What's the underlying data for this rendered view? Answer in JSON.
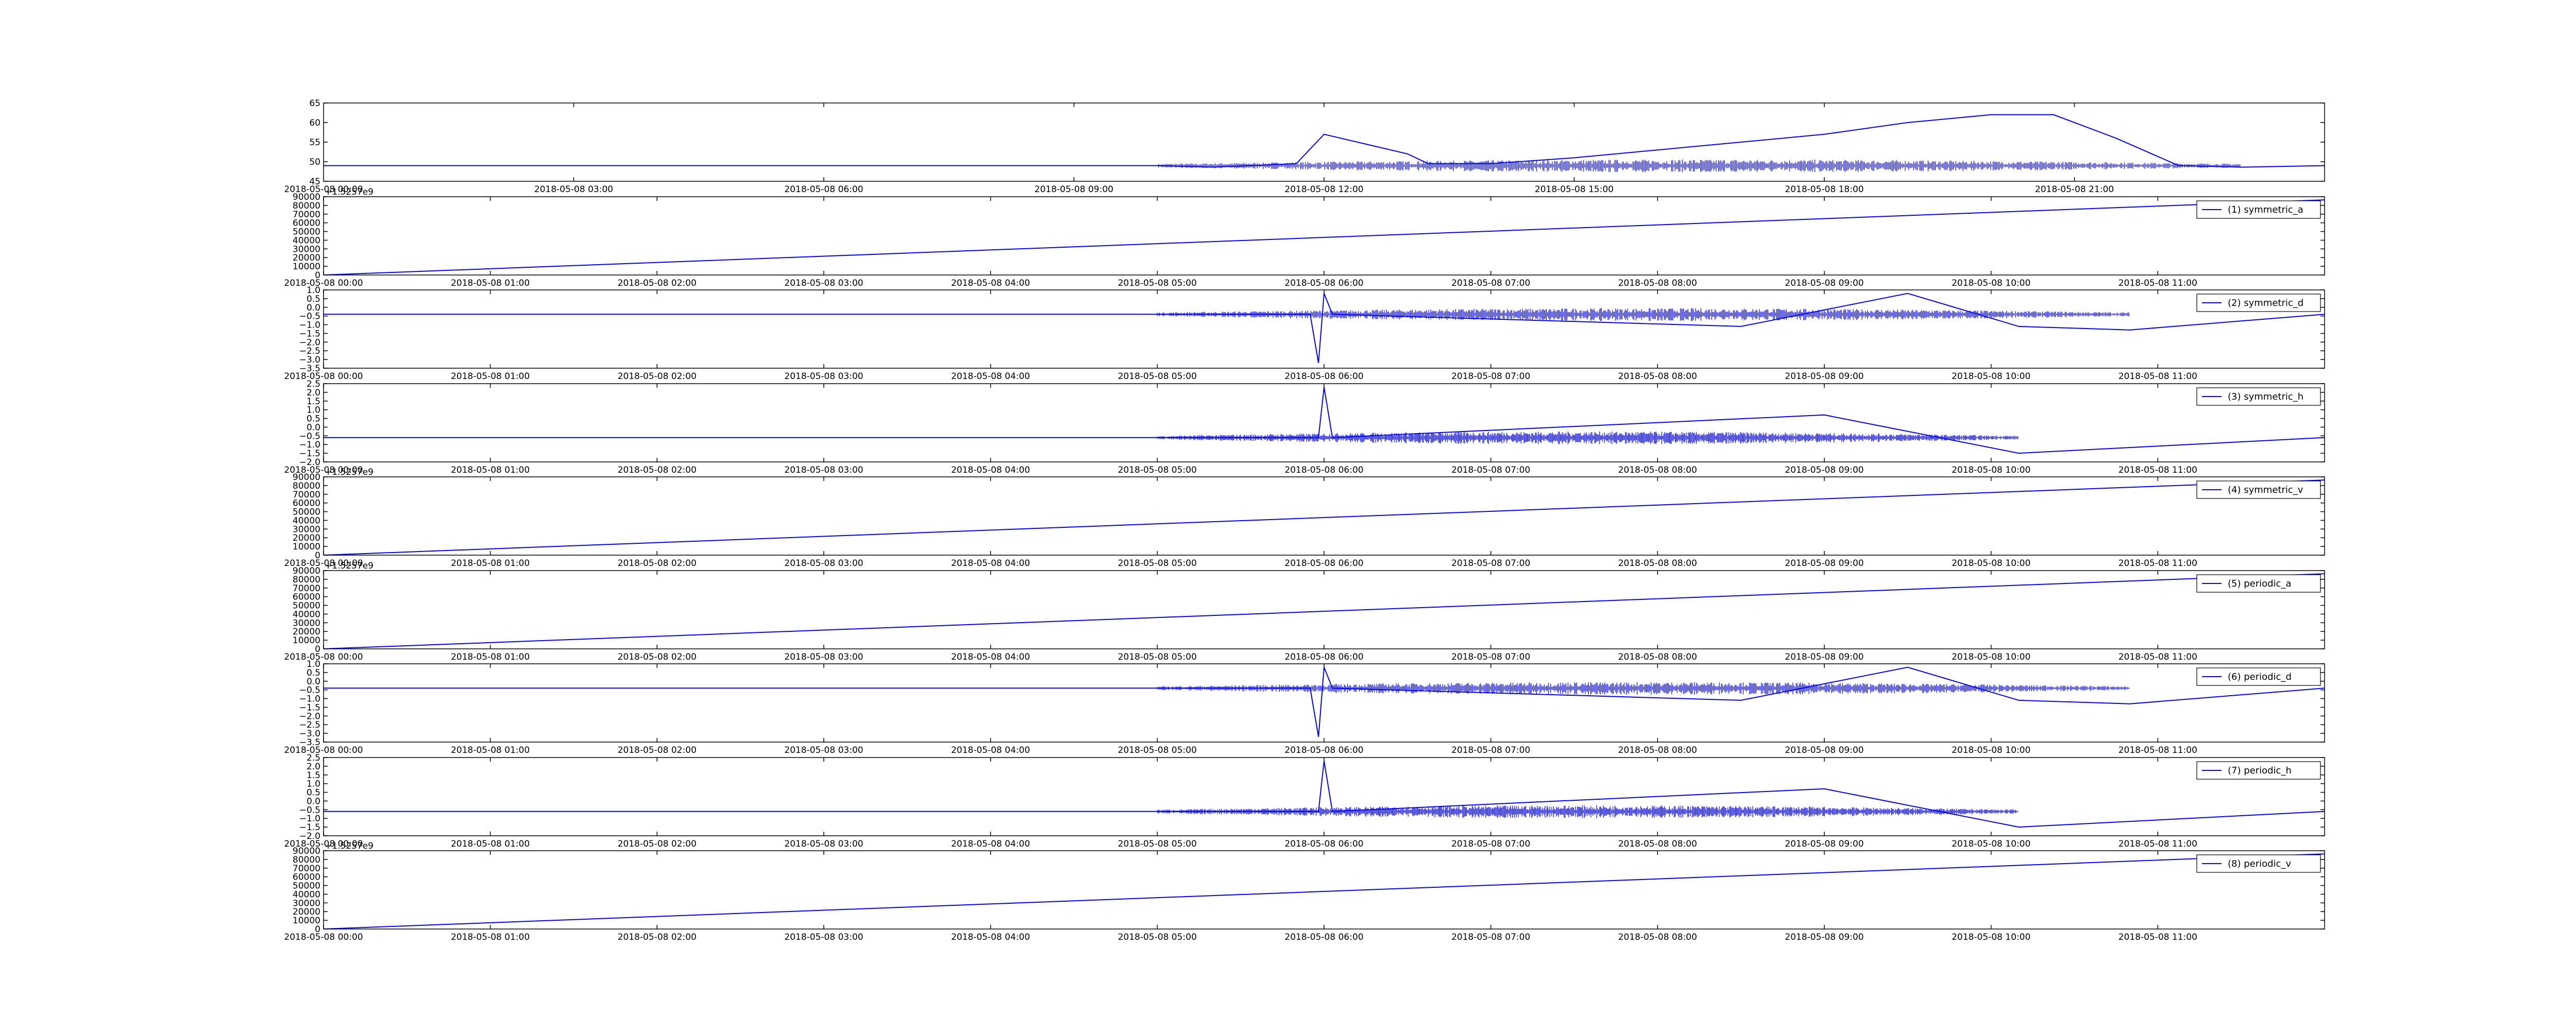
{
  "colors": {
    "line": "#0000ff",
    "axes": "#000000",
    "background": "#ffffff"
  },
  "chart_data": [
    {
      "type": "line",
      "x_axis": "datetime",
      "xlim": [
        "2018-05-08 00:00",
        "2018-05-08 24:00"
      ],
      "xticks": [
        "2018-05-08 03:00",
        "2018-05-08 06:00",
        "2018-05-08 09:00",
        "2018-05-08 12:00",
        "2018-05-08 15:00",
        "2018-05-08 18:00",
        "2018-05-08 21:00"
      ],
      "xtick_labels": [
        "2018-05-08 03:00",
        "2018-05-08 06:00",
        "2018-05-08 09:00",
        "2018-05-08 12:00",
        "2018-05-08 15:00",
        "2018-05-08 18:00",
        "2018-05-08 21:00"
      ],
      "first_xtick_label": "2018-05-08 00:00",
      "ylim": [
        45,
        65
      ],
      "yticks": [
        45,
        50,
        55,
        60,
        65
      ],
      "offset_label": "",
      "legend": "",
      "series": [
        {
          "x": [
            "2018-05-08 00:00",
            "2018-05-08 10:00",
            "2018-05-08 10:40",
            "2018-05-08 11:40",
            "2018-05-08 12:00",
            "2018-05-08 13:00",
            "2018-05-08 13:15",
            "2018-05-08 14:00",
            "2018-05-08 15:00",
            "2018-05-08 16:00",
            "2018-05-08 17:00",
            "2018-05-08 18:00",
            "2018-05-08 19:00",
            "2018-05-08 20:00",
            "2018-05-08 20:45",
            "2018-05-08 21:30",
            "2018-05-08 22:15",
            "2018-05-08 23:00",
            "2018-05-08 24:00"
          ],
          "values": [
            49,
            49,
            48.6,
            49.5,
            57,
            52,
            49.5,
            49.5,
            51,
            53,
            55,
            57,
            60,
            62,
            62,
            56,
            49,
            48.6,
            49
          ]
        }
      ]
    },
    {
      "type": "line",
      "x_axis": "datetime",
      "xlim": [
        "2018-05-08 00:00",
        "2018-05-08 12:00"
      ],
      "xticks": [
        "2018-05-08 00:00",
        "2018-05-08 01:00",
        "2018-05-08 02:00",
        "2018-05-08 03:00",
        "2018-05-08 04:00",
        "2018-05-08 05:00",
        "2018-05-08 06:00",
        "2018-05-08 07:00",
        "2018-05-08 08:00",
        "2018-05-08 09:00",
        "2018-05-08 10:00",
        "2018-05-08 11:00"
      ],
      "xtick_labels": [
        "2018-05-08 00:00",
        "2018-05-08 01:00",
        "2018-05-08 02:00",
        "2018-05-08 03:00",
        "2018-05-08 04:00",
        "2018-05-08 05:00",
        "2018-05-08 06:00",
        "2018-05-08 07:00",
        "2018-05-08 08:00",
        "2018-05-08 09:00",
        "2018-05-08 10:00",
        "2018-05-08 11:00"
      ],
      "ylim": [
        0,
        90000
      ],
      "yticks": [
        0,
        10000,
        20000,
        30000,
        40000,
        50000,
        60000,
        70000,
        80000,
        90000
      ],
      "offset_label": "+1.5257e9",
      "legend": "(1) symmetric_a",
      "series": [
        {
          "name": "(1) symmetric_a",
          "x": [
            "2018-05-08 00:00",
            "2018-05-08 12:00"
          ],
          "values": [
            0,
            86400
          ]
        }
      ]
    },
    {
      "type": "line",
      "x_axis": "datetime",
      "xlim": [
        "2018-05-08 00:00",
        "2018-05-08 12:00"
      ],
      "xticks": [
        "2018-05-08 00:00",
        "2018-05-08 01:00",
        "2018-05-08 02:00",
        "2018-05-08 03:00",
        "2018-05-08 04:00",
        "2018-05-08 05:00",
        "2018-05-08 06:00",
        "2018-05-08 07:00",
        "2018-05-08 08:00",
        "2018-05-08 09:00",
        "2018-05-08 10:00",
        "2018-05-08 11:00"
      ],
      "xtick_labels": [
        "2018-05-08 00:00",
        "2018-05-08 01:00",
        "2018-05-08 02:00",
        "2018-05-08 03:00",
        "2018-05-08 04:00",
        "2018-05-08 05:00",
        "2018-05-08 06:00",
        "2018-05-08 07:00",
        "2018-05-08 08:00",
        "2018-05-08 09:00",
        "2018-05-08 10:00",
        "2018-05-08 11:00"
      ],
      "ylim": [
        -3.5,
        1.0
      ],
      "yticks": [
        -3.5,
        -3.0,
        -2.5,
        -2.0,
        -1.5,
        -1.0,
        -0.5,
        0.0,
        0.5,
        1.0
      ],
      "offset_label": "",
      "legend": "(2) symmetric_d",
      "series": [
        {
          "name": "(2) symmetric_d",
          "x": [
            "2018-05-08 00:00",
            "2018-05-08 05:00",
            "2018-05-08 05:55",
            "2018-05-08 05:58",
            "2018-05-08 06:00",
            "2018-05-08 06:03",
            "2018-05-08 08:30",
            "2018-05-08 09:30",
            "2018-05-08 10:10",
            "2018-05-08 10:50",
            "2018-05-08 12:00"
          ],
          "values": [
            -0.4,
            -0.4,
            -0.4,
            -3.2,
            0.8,
            -0.4,
            -1.1,
            0.8,
            -1.1,
            -1.3,
            -0.4
          ]
        }
      ]
    },
    {
      "type": "line",
      "x_axis": "datetime",
      "xlim": [
        "2018-05-08 00:00",
        "2018-05-08 12:00"
      ],
      "xticks": [
        "2018-05-08 00:00",
        "2018-05-08 01:00",
        "2018-05-08 02:00",
        "2018-05-08 03:00",
        "2018-05-08 04:00",
        "2018-05-08 05:00",
        "2018-05-08 06:00",
        "2018-05-08 07:00",
        "2018-05-08 08:00",
        "2018-05-08 09:00",
        "2018-05-08 10:00",
        "2018-05-08 11:00"
      ],
      "xtick_labels": [
        "2018-05-08 00:00",
        "2018-05-08 01:00",
        "2018-05-08 02:00",
        "2018-05-08 03:00",
        "2018-05-08 04:00",
        "2018-05-08 05:00",
        "2018-05-08 06:00",
        "2018-05-08 07:00",
        "2018-05-08 08:00",
        "2018-05-08 09:00",
        "2018-05-08 10:00",
        "2018-05-08 11:00"
      ],
      "ylim": [
        -2.0,
        2.5
      ],
      "yticks": [
        -2.0,
        -1.5,
        -1.0,
        -0.5,
        0.0,
        0.5,
        1.0,
        1.5,
        2.0,
        2.5
      ],
      "offset_label": "",
      "legend": "(3) symmetric_h",
      "series": [
        {
          "name": "(3) symmetric_h",
          "x": [
            "2018-05-08 00:00",
            "2018-05-08 05:00",
            "2018-05-08 05:58",
            "2018-05-08 06:00",
            "2018-05-08 06:03",
            "2018-05-08 09:00",
            "2018-05-08 10:10",
            "2018-05-08 12:00"
          ],
          "values": [
            -0.6,
            -0.6,
            -0.6,
            2.3,
            -0.6,
            0.7,
            -1.5,
            -0.6
          ]
        }
      ]
    },
    {
      "type": "line",
      "x_axis": "datetime",
      "xlim": [
        "2018-05-08 00:00",
        "2018-05-08 12:00"
      ],
      "xticks": [
        "2018-05-08 00:00",
        "2018-05-08 01:00",
        "2018-05-08 02:00",
        "2018-05-08 03:00",
        "2018-05-08 04:00",
        "2018-05-08 05:00",
        "2018-05-08 06:00",
        "2018-05-08 07:00",
        "2018-05-08 08:00",
        "2018-05-08 09:00",
        "2018-05-08 10:00",
        "2018-05-08 11:00"
      ],
      "xtick_labels": [
        "2018-05-08 00:00",
        "2018-05-08 01:00",
        "2018-05-08 02:00",
        "2018-05-08 03:00",
        "2018-05-08 04:00",
        "2018-05-08 05:00",
        "2018-05-08 06:00",
        "2018-05-08 07:00",
        "2018-05-08 08:00",
        "2018-05-08 09:00",
        "2018-05-08 10:00",
        "2018-05-08 11:00"
      ],
      "ylim": [
        0,
        90000
      ],
      "yticks": [
        0,
        10000,
        20000,
        30000,
        40000,
        50000,
        60000,
        70000,
        80000,
        90000
      ],
      "offset_label": "+1.5257e9",
      "legend": "(4) symmetric_v",
      "series": [
        {
          "name": "(4) symmetric_v",
          "x": [
            "2018-05-08 00:00",
            "2018-05-08 12:00"
          ],
          "values": [
            0,
            86400
          ]
        }
      ]
    },
    {
      "type": "line",
      "x_axis": "datetime",
      "xlim": [
        "2018-05-08 00:00",
        "2018-05-08 12:00"
      ],
      "xticks": [
        "2018-05-08 00:00",
        "2018-05-08 01:00",
        "2018-05-08 02:00",
        "2018-05-08 03:00",
        "2018-05-08 04:00",
        "2018-05-08 05:00",
        "2018-05-08 06:00",
        "2018-05-08 07:00",
        "2018-05-08 08:00",
        "2018-05-08 09:00",
        "2018-05-08 10:00",
        "2018-05-08 11:00"
      ],
      "xtick_labels": [
        "2018-05-08 00:00",
        "2018-05-08 01:00",
        "2018-05-08 02:00",
        "2018-05-08 03:00",
        "2018-05-08 04:00",
        "2018-05-08 05:00",
        "2018-05-08 06:00",
        "2018-05-08 07:00",
        "2018-05-08 08:00",
        "2018-05-08 09:00",
        "2018-05-08 10:00",
        "2018-05-08 11:00"
      ],
      "ylim": [
        0,
        90000
      ],
      "yticks": [
        0,
        10000,
        20000,
        30000,
        40000,
        50000,
        60000,
        70000,
        80000,
        90000
      ],
      "offset_label": "+1.5257e9",
      "legend": "(5) periodic_a",
      "series": [
        {
          "name": "(5) periodic_a",
          "x": [
            "2018-05-08 00:00",
            "2018-05-08 12:00"
          ],
          "values": [
            0,
            86400
          ]
        }
      ]
    },
    {
      "type": "line",
      "x_axis": "datetime",
      "xlim": [
        "2018-05-08 00:00",
        "2018-05-08 12:00"
      ],
      "xticks": [
        "2018-05-08 00:00",
        "2018-05-08 01:00",
        "2018-05-08 02:00",
        "2018-05-08 03:00",
        "2018-05-08 04:00",
        "2018-05-08 05:00",
        "2018-05-08 06:00",
        "2018-05-08 07:00",
        "2018-05-08 08:00",
        "2018-05-08 09:00",
        "2018-05-08 10:00",
        "2018-05-08 11:00"
      ],
      "xtick_labels": [
        "2018-05-08 00:00",
        "2018-05-08 01:00",
        "2018-05-08 02:00",
        "2018-05-08 03:00",
        "2018-05-08 04:00",
        "2018-05-08 05:00",
        "2018-05-08 06:00",
        "2018-05-08 07:00",
        "2018-05-08 08:00",
        "2018-05-08 09:00",
        "2018-05-08 10:00",
        "2018-05-08 11:00"
      ],
      "ylim": [
        -3.5,
        1.0
      ],
      "yticks": [
        -3.5,
        -3.0,
        -2.5,
        -2.0,
        -1.5,
        -1.0,
        -0.5,
        0.0,
        0.5,
        1.0
      ],
      "offset_label": "",
      "legend": "(6) periodic_d",
      "series": [
        {
          "name": "(6) periodic_d",
          "x": [
            "2018-05-08 00:00",
            "2018-05-08 05:00",
            "2018-05-08 05:55",
            "2018-05-08 05:58",
            "2018-05-08 06:00",
            "2018-05-08 06:03",
            "2018-05-08 08:30",
            "2018-05-08 09:30",
            "2018-05-08 10:10",
            "2018-05-08 10:50",
            "2018-05-08 12:00"
          ],
          "values": [
            -0.4,
            -0.4,
            -0.4,
            -3.2,
            0.8,
            -0.4,
            -1.1,
            0.8,
            -1.1,
            -1.3,
            -0.4
          ]
        }
      ]
    },
    {
      "type": "line",
      "x_axis": "datetime",
      "xlim": [
        "2018-05-08 00:00",
        "2018-05-08 12:00"
      ],
      "xticks": [
        "2018-05-08 00:00",
        "2018-05-08 01:00",
        "2018-05-08 02:00",
        "2018-05-08 03:00",
        "2018-05-08 04:00",
        "2018-05-08 05:00",
        "2018-05-08 06:00",
        "2018-05-08 07:00",
        "2018-05-08 08:00",
        "2018-05-08 09:00",
        "2018-05-08 10:00",
        "2018-05-08 11:00"
      ],
      "xtick_labels": [
        "2018-05-08 00:00",
        "2018-05-08 01:00",
        "2018-05-08 02:00",
        "2018-05-08 03:00",
        "2018-05-08 04:00",
        "2018-05-08 05:00",
        "2018-05-08 06:00",
        "2018-05-08 07:00",
        "2018-05-08 08:00",
        "2018-05-08 09:00",
        "2018-05-08 10:00",
        "2018-05-08 11:00"
      ],
      "ylim": [
        -2.0,
        2.5
      ],
      "yticks": [
        -2.0,
        -1.5,
        -1.0,
        -0.5,
        0.0,
        0.5,
        1.0,
        1.5,
        2.0,
        2.5
      ],
      "offset_label": "",
      "legend": "(7) periodic_h",
      "series": [
        {
          "name": "(7) periodic_h",
          "x": [
            "2018-05-08 00:00",
            "2018-05-08 05:00",
            "2018-05-08 05:58",
            "2018-05-08 06:00",
            "2018-05-08 06:03",
            "2018-05-08 09:00",
            "2018-05-08 10:10",
            "2018-05-08 12:00"
          ],
          "values": [
            -0.6,
            -0.6,
            -0.6,
            2.3,
            -0.6,
            0.7,
            -1.5,
            -0.6
          ]
        }
      ]
    },
    {
      "type": "line",
      "x_axis": "datetime",
      "xlim": [
        "2018-05-08 00:00",
        "2018-05-08 12:00"
      ],
      "xticks": [
        "2018-05-08 00:00",
        "2018-05-08 01:00",
        "2018-05-08 02:00",
        "2018-05-08 03:00",
        "2018-05-08 04:00",
        "2018-05-08 05:00",
        "2018-05-08 06:00",
        "2018-05-08 07:00",
        "2018-05-08 08:00",
        "2018-05-08 09:00",
        "2018-05-08 10:00",
        "2018-05-08 11:00"
      ],
      "xtick_labels": [
        "2018-05-08 00:00",
        "2018-05-08 01:00",
        "2018-05-08 02:00",
        "2018-05-08 03:00",
        "2018-05-08 04:00",
        "2018-05-08 05:00",
        "2018-05-08 06:00",
        "2018-05-08 07:00",
        "2018-05-08 08:00",
        "2018-05-08 09:00",
        "2018-05-08 10:00",
        "2018-05-08 11:00"
      ],
      "ylim": [
        0,
        90000
      ],
      "yticks": [
        0,
        10000,
        20000,
        30000,
        40000,
        50000,
        60000,
        70000,
        80000,
        90000
      ],
      "offset_label": "+1.5257e9",
      "legend": "(8) periodic_v",
      "series": [
        {
          "name": "(8) periodic_v",
          "x": [
            "2018-05-08 00:00",
            "2018-05-08 12:00"
          ],
          "values": [
            0,
            86400
          ]
        }
      ]
    }
  ]
}
